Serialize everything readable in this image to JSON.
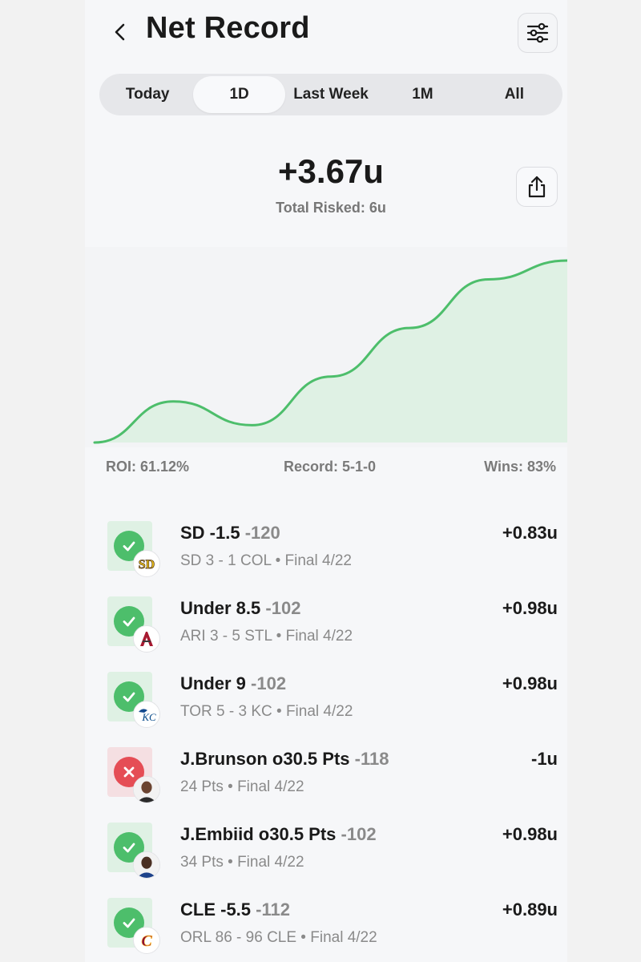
{
  "header": {
    "title": "Net Record"
  },
  "tabs": [
    {
      "label": "Today",
      "active": false
    },
    {
      "label": "1D",
      "active": true
    },
    {
      "label": "Last Week",
      "active": false
    },
    {
      "label": "1M",
      "active": false
    },
    {
      "label": "All",
      "active": false
    }
  ],
  "summary": {
    "value": "+3.67u",
    "total_risked": "Total Risked: 6u"
  },
  "chart_data": {
    "type": "area",
    "title": "",
    "xlabel": "",
    "ylabel": "",
    "grid": false,
    "legend": "none",
    "x": [
      0,
      1,
      2,
      3,
      4,
      5,
      6
    ],
    "series": [
      {
        "values": [
          0,
          0.83,
          0.35,
          1.33,
          2.31,
          3.29,
          3.67
        ]
      }
    ],
    "line_color": "#4dbe6b",
    "fill_color": "#dff1e4"
  },
  "stats": {
    "roi": "ROI: 61.12%",
    "record": "Record: 5-1-0",
    "wins": "Wins: 83%"
  },
  "bets": [
    {
      "pick": "SD -1.5",
      "odds": "-120",
      "detail": "SD 3 - 1 COL • Final 4/22",
      "result": "+0.83u",
      "status": "win",
      "logo": "padres-logo"
    },
    {
      "pick": "Under 8.5",
      "odds": "-102",
      "detail": "ARI 3 - 5 STL • Final 4/22",
      "result": "+0.98u",
      "status": "win",
      "logo": "diamondbacks-logo"
    },
    {
      "pick": "Under 9",
      "odds": "-102",
      "detail": "TOR 5 - 3 KC • Final 4/22",
      "result": "+0.98u",
      "status": "win",
      "logo": "bluejays-royals-logo"
    },
    {
      "pick": "J.Brunson o30.5 Pts",
      "odds": "-118",
      "detail": "24 Pts • Final 4/22",
      "result": "-1u",
      "status": "loss",
      "logo": "player-avatar"
    },
    {
      "pick": "J.Embiid o30.5 Pts",
      "odds": "-102",
      "detail": "34 Pts • Final 4/22",
      "result": "+0.98u",
      "status": "win",
      "logo": "player-avatar"
    },
    {
      "pick": "CLE -5.5",
      "odds": "-112",
      "detail": "ORL 86 - 96 CLE • Final 4/22",
      "result": "+0.89u",
      "status": "win",
      "logo": "cavaliers-logo"
    }
  ],
  "colors": {
    "accent_green": "#4dbe6b",
    "loss_red": "#e54d55"
  }
}
